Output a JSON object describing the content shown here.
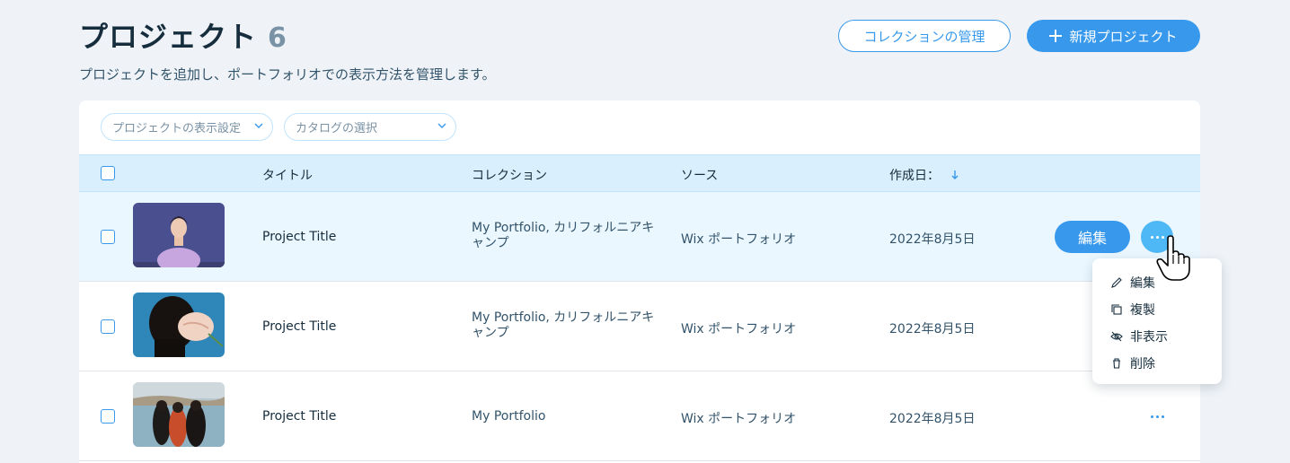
{
  "header": {
    "title": "プロジェクト",
    "count": "6",
    "subtitle": "プロジェクトを追加し、ポートフォリオでの表示方法を管理します。"
  },
  "actions": {
    "manage_collections": "コレクションの管理",
    "new_project": "新規プロジェクト"
  },
  "filters": {
    "display_settings": "プロジェクトの表示設定",
    "catalog": "カタログの選択"
  },
  "table": {
    "columns": {
      "title": "タイトル",
      "collection": "コレクション",
      "source": "ソース",
      "created": "作成日："
    },
    "rows": [
      {
        "title": "Project Title",
        "collection": "My Portfolio, カリフォルニアキャンプ",
        "source": "Wix ポートフォリオ",
        "date": "2022年8月5日"
      },
      {
        "title": "Project Title",
        "collection": "My Portfolio, カリフォルニアキャンプ",
        "source": "Wix ポートフォリオ",
        "date": "2022年8月5日"
      },
      {
        "title": "Project Title",
        "collection": "My Portfolio",
        "source": "Wix ポートフォリオ",
        "date": "2022年8月5日"
      }
    ],
    "edit_label": "編集"
  },
  "menu": {
    "edit": "編集",
    "duplicate": "複製",
    "hide": "非表示",
    "delete": "削除"
  },
  "icons": [
    "plus-icon",
    "chevron-down-icon",
    "sort-down-icon",
    "more-icon",
    "pencil-icon",
    "duplicate-icon",
    "eye-off-icon",
    "trash-icon",
    "hand-cursor-icon"
  ],
  "colors": {
    "accent": "#3899ec",
    "header_bg": "#daeffe",
    "hover_row": "#eaf7ff",
    "page_bg": "#eff3f7"
  }
}
